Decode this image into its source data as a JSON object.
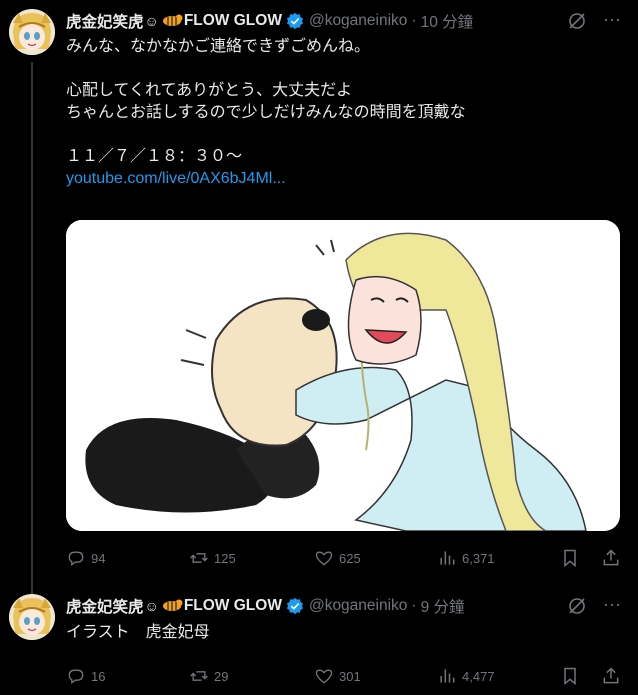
{
  "tweets": [
    {
      "author_name": "虎金妃笑虎",
      "author_suffix": "FLOW GLOW",
      "handle": "@koganeiniko",
      "separator": "·",
      "time": "10 分鐘",
      "text_lines": [
        "みんな、なかなかご連絡できずごめんね。",
        "",
        "心配してくれてありがとう、大丈夫だよ",
        "ちゃんとお話しするので少しだけみんなの時間を頂戴な",
        "",
        "１１／７／１８：３０～"
      ],
      "link": "youtube.com/live/0AX6bJ4Ml...",
      "stats": {
        "replies": "94",
        "retweets": "125",
        "likes": "625",
        "views": "6,371"
      }
    },
    {
      "author_name": "虎金妃笑虎",
      "author_suffix": "FLOW GLOW",
      "handle": "@koganeiniko",
      "separator": "·",
      "time": "9 分鐘",
      "text": "イラスト　虎金妃母",
      "stats": {
        "replies": "16",
        "retweets": "29",
        "likes": "301",
        "views": "4,477"
      }
    }
  ],
  "colors": {
    "background": "#000000",
    "text": "#e7e9ea",
    "muted": "#71767b",
    "link": "#1d9bf0",
    "verified": "#1d9bf0"
  },
  "icons": [
    "smiling-face-emoji",
    "tiger-emoji",
    "verified-badge-icon",
    "grok-icon",
    "more-icon",
    "reply-icon",
    "retweet-icon",
    "like-icon",
    "views-icon",
    "bookmark-icon",
    "share-icon"
  ]
}
